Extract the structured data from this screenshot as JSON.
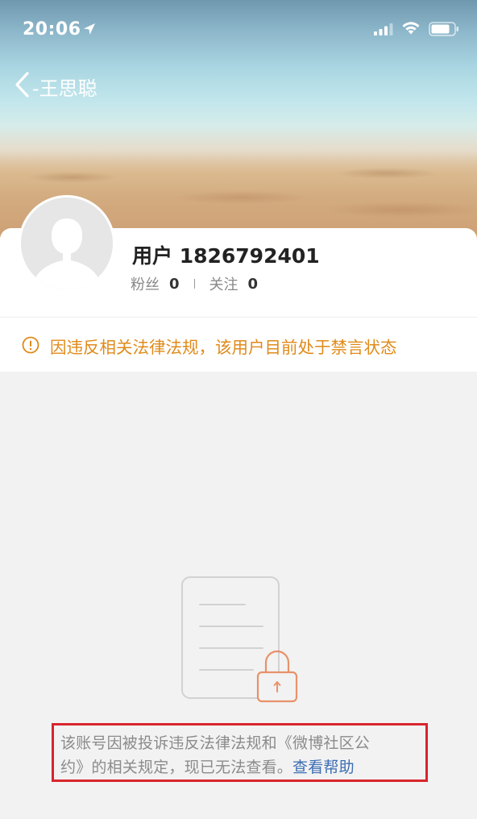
{
  "status_bar": {
    "time": "20:06"
  },
  "nav": {
    "title": "-王思聪"
  },
  "profile": {
    "username": "用户 1826792401",
    "followers_label": "粉丝",
    "followers_count": "0",
    "following_label": "关注",
    "following_count": "0"
  },
  "notice": {
    "text": "因违反相关法律法规，该用户目前处于禁言状态"
  },
  "message": {
    "line1": "该账号因被投诉违反法律法规和《微博社区公",
    "line2": "约》的相关规定，现已无法查看。",
    "help_link": "查看帮助"
  },
  "icons": {
    "location": "location-arrow-icon",
    "signal": "cellular-signal-icon",
    "wifi": "wifi-icon",
    "battery": "battery-icon",
    "back": "back-chevron-icon",
    "alert": "alert-circle-icon",
    "avatar": "default-avatar-icon",
    "locked_document": "locked-document-icon"
  },
  "colors": {
    "notice": "#e08a19",
    "link": "#3c6db3",
    "highlight_border": "#d9242c",
    "lock": "#e8916a",
    "muted_text": "#8b8b8b"
  }
}
